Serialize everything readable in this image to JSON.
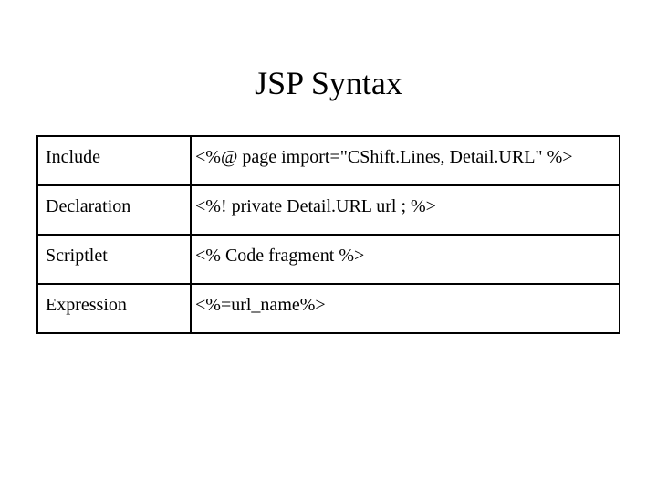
{
  "title": "JSP Syntax",
  "rows": [
    {
      "label": "Include",
      "syntax": "<%@ page import=\"CShift.Lines, Detail.URL\" %>"
    },
    {
      "label": "Declaration",
      "syntax": "<%! private Detail.URL url ; %>"
    },
    {
      "label": "Scriptlet",
      "syntax": "<% Code fragment %>"
    },
    {
      "label": "Expression",
      "syntax": " <%=url_name%>"
    }
  ]
}
